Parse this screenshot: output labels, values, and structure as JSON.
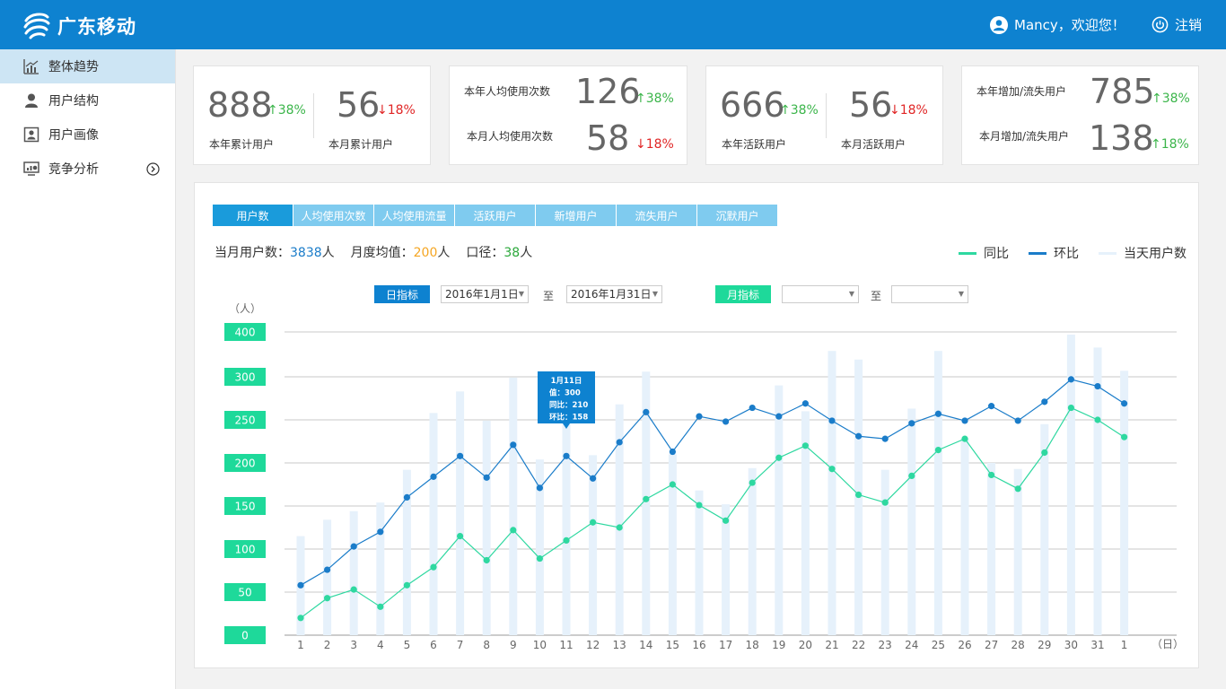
{
  "header": {
    "brand": "广东移动",
    "greeting": "Mancy，欢迎您！",
    "logout_label": "注销",
    "bg_color": "#0e82d0"
  },
  "sidebar": {
    "items": [
      {
        "label": "整体趋势",
        "icon": "trend-chart-icon",
        "active": true
      },
      {
        "label": "用户结构",
        "icon": "user-icon",
        "active": false
      },
      {
        "label": "用户画像",
        "icon": "profile-card-icon",
        "active": false
      },
      {
        "label": "竞争分析",
        "icon": "monitor-chart-icon",
        "active": false
      }
    ]
  },
  "cards": [
    {
      "a": {
        "value": "888",
        "change": "↑38%",
        "dir": "up",
        "label": "本年累计用户"
      },
      "b": {
        "value": "56",
        "change": "↓18%",
        "dir": "down",
        "label": "本月累计用户"
      }
    },
    {
      "a": {
        "value": "126",
        "change": "↑38%",
        "dir": "up",
        "label": "本年人均使用次数"
      },
      "b": {
        "value": "58",
        "change": "↓18%",
        "dir": "down",
        "label": "本月人均使用次数"
      }
    },
    {
      "a": {
        "value": "666",
        "change": "↑38%",
        "dir": "up",
        "label": "本年活跃用户"
      },
      "b": {
        "value": "56",
        "change": "↓18%",
        "dir": "down",
        "label": "本月活跃用户"
      }
    },
    {
      "a": {
        "value": "785",
        "change": "↑38%",
        "dir": "up",
        "label": "本年增加/流失用户"
      },
      "b": {
        "value": "138",
        "change": "↑18%",
        "dir": "up",
        "label": "本月增加/流失用户"
      }
    }
  ],
  "tabs": [
    "用户数",
    "人均使用次数",
    "人均使用流量",
    "活跃用户",
    "新增用户",
    "流失用户",
    "沉默用户"
  ],
  "summary": {
    "month_users_label": "当月用户数：",
    "month_users_value": "3838",
    "month_users_unit": "人",
    "month_avg_label": "月度均值：",
    "month_avg_value": "200",
    "month_avg_unit": "人",
    "caliber_label": "口径：",
    "caliber_value": "38",
    "caliber_unit": "人"
  },
  "filters": {
    "daily_label": "日指标",
    "daily_from": "2016年1月1日",
    "to_label": "至",
    "daily_to": "2016年1月31日",
    "monthly_label": "月指标",
    "monthly_from": "",
    "monthly_to": ""
  },
  "colors": {
    "yoy": "#2ed8a0",
    "mom": "#1a7cc9",
    "bars": "#e6f1fb",
    "ytag": "#1ed99a"
  },
  "chart_data": {
    "type": "line",
    "x": [
      "1",
      "2",
      "3",
      "4",
      "5",
      "6",
      "7",
      "8",
      "9",
      "10",
      "11",
      "12",
      "13",
      "14",
      "15",
      "16",
      "17",
      "18",
      "19",
      "20",
      "21",
      "22",
      "23",
      "24",
      "25",
      "26",
      "27",
      "28",
      "29",
      "30",
      "31",
      "1"
    ],
    "x_unit": "（日）",
    "y_unit": "（人）",
    "y_ticks": [
      0,
      50,
      100,
      150,
      200,
      250,
      300,
      400
    ],
    "ylim": [
      0,
      350
    ],
    "grid": true,
    "legend": {
      "position": "top-right",
      "items": [
        "同比",
        "环比",
        "当天用户数"
      ]
    },
    "series": [
      {
        "name": "同比",
        "kind": "line",
        "values": [
          20,
          43,
          53,
          33,
          58,
          79,
          115,
          87,
          122,
          89,
          110,
          131,
          125,
          158,
          175,
          151,
          133,
          177,
          206,
          220,
          193,
          163,
          154,
          185,
          215,
          228,
          186,
          170,
          212,
          264,
          250,
          230
        ]
      },
      {
        "name": "环比",
        "kind": "line",
        "values": [
          58,
          76,
          103,
          120,
          160,
          184,
          208,
          183,
          221,
          171,
          208,
          182,
          224,
          259,
          213,
          254,
          248,
          264,
          254,
          269,
          249,
          231,
          228,
          246,
          257,
          249,
          266,
          249,
          271,
          297,
          289,
          269
        ]
      },
      {
        "name": "当天用户数",
        "kind": "bar",
        "values": [
          115,
          134,
          144,
          154,
          192,
          258,
          283,
          249,
          299,
          204,
          246,
          209,
          268,
          306,
          210,
          168,
          152,
          194,
          290,
          260,
          330,
          320,
          192,
          263,
          330,
          228,
          200,
          193,
          245,
          349,
          334,
          307
        ]
      }
    ],
    "tooltip": {
      "index": 10,
      "lines": [
        "1月11日",
        "值：300",
        "同比：210",
        "环比：158"
      ]
    }
  }
}
